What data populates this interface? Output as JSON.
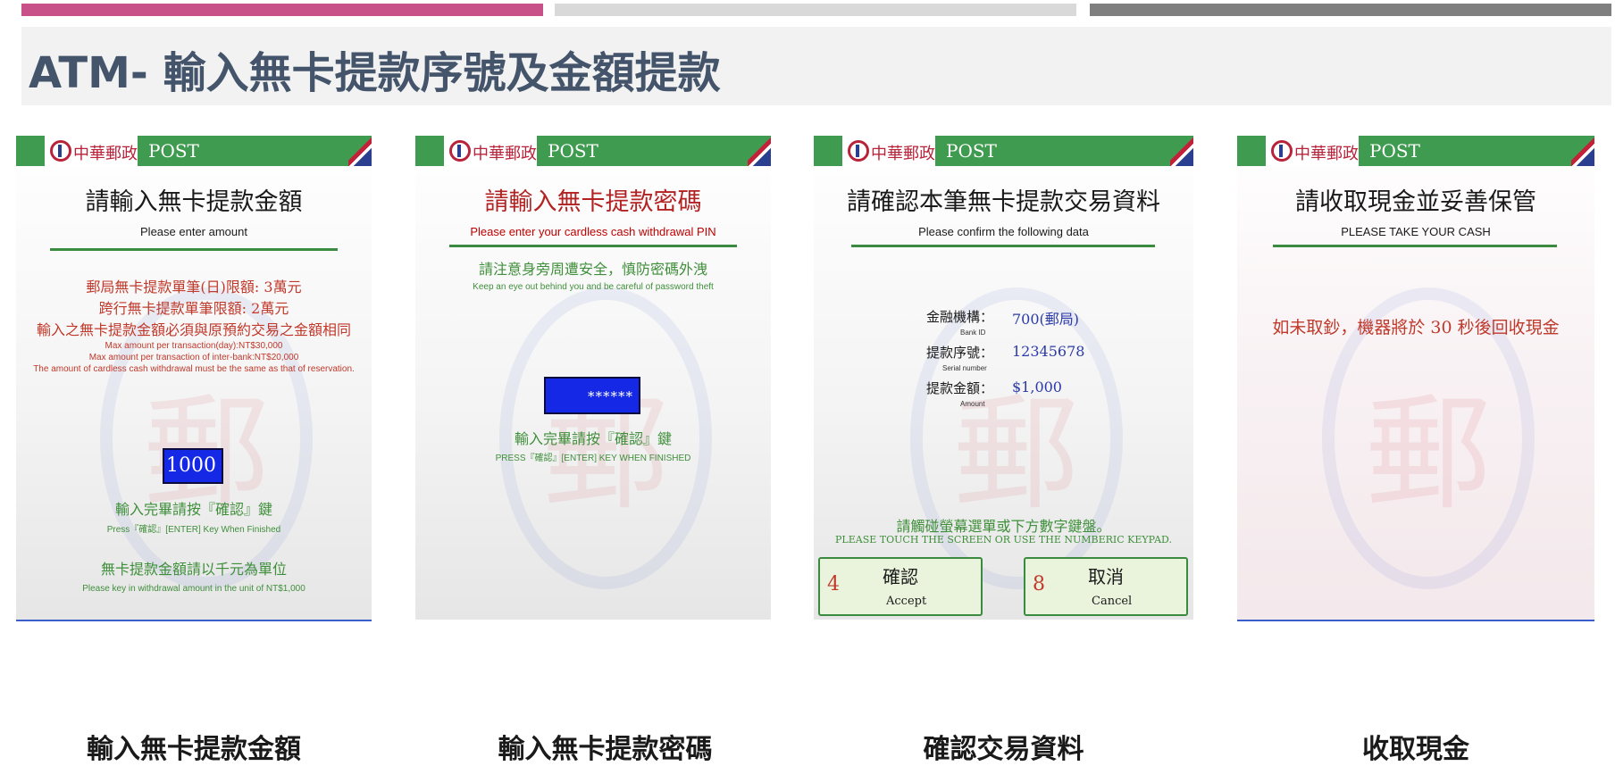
{
  "title": "ATM- 輸入無卡提款序號及金額提款",
  "brand": {
    "logo_text": "中華郵政",
    "post": "POST",
    "green": "#3f9b4f",
    "accent": "#c9518a"
  },
  "screens": [
    {
      "heading": "請輸入無卡提款金額",
      "subheading": "Please enter amount",
      "notes": [
        "郵局無卡提款單筆(日)限額: 3萬元",
        "跨行無卡提款單筆限額: 2萬元",
        "輸入之無卡提款金額必須與原預約交易之金額相同"
      ],
      "notes_en": [
        "Max amount per transaction(day):NT$30,000",
        "Max amount per transaction of inter-bank:NT$20,000",
        "The amount of cardless cash withdrawal must be the same as that of reservation."
      ],
      "input_value": "1000",
      "enter_cn": "輸入完畢請按『確認』鍵",
      "enter_en": "Press『確認』[ENTER] Key When Finished",
      "unit_cn": "無卡提款金額請以千元為單位",
      "unit_en": "Please key in withdrawal amount in the unit of NT$1,000"
    },
    {
      "heading": "請輸入無卡提款密碼",
      "subheading": "Please enter your cardless cash withdrawal PIN",
      "warn_cn": "請注意身旁周遭安全，慎防密碼外洩",
      "warn_en": "Keep an eye out behind you and be careful of password theft",
      "input_value": "******",
      "enter_cn": "輸入完畢請按『確認』鍵",
      "enter_en": "PRESS『確認』[ENTER] KEY WHEN FINISHED"
    },
    {
      "heading": "請確認本筆無卡提款交易資料",
      "subheading": "Please confirm the following data",
      "rows": [
        {
          "label": "金融機構：",
          "label_en": "Bank ID",
          "value": "700(郵局)"
        },
        {
          "label": "提款序號：",
          "label_en": "Serial number",
          "value": "12345678"
        },
        {
          "label": "提款金額：",
          "label_en": "Amount",
          "value": "$1,000"
        }
      ],
      "touch_cn": "請觸碰螢幕選單或下方數字鍵盤。",
      "touch_en": "PLEASE TOUCH THE SCREEN OR USE THE NUMBERIC KEYPAD.",
      "accept": {
        "num": "4",
        "cn": "確認",
        "en": "Accept"
      },
      "cancel": {
        "num": "8",
        "cn": "取消",
        "en": "Cancel"
      }
    },
    {
      "heading": "請收取現金並妥善保管",
      "subheading": "PLEASE TAKE YOUR CASH",
      "notice": "如未取鈔，機器將於 30 秒後回收現金"
    }
  ],
  "captions": [
    "輸入無卡提款金額",
    "輸入無卡提款密碼",
    "確認交易資料",
    "收取現金"
  ]
}
